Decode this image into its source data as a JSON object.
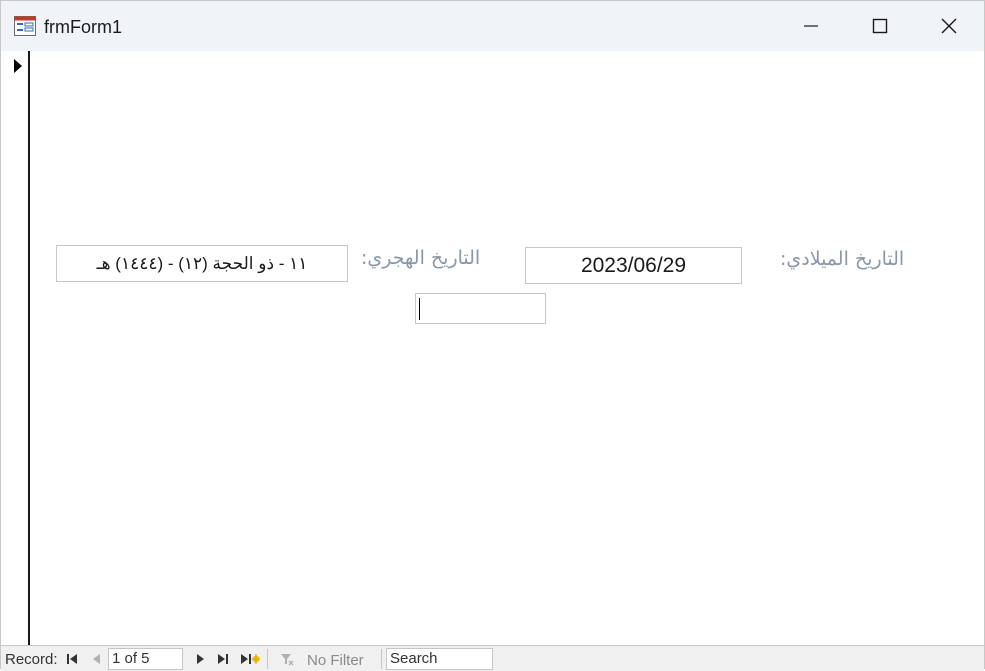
{
  "window": {
    "title": "frmForm1",
    "controls": {
      "minimize": "minimize-icon",
      "maximize": "maximize-icon",
      "close": "close-icon"
    }
  },
  "form": {
    "gregorian_label": "التاريخ الميلادي:",
    "gregorian_value": "2023/06/29",
    "hijri_label": "التاريخ الهجري:",
    "hijri_value": "١١ - ذو الحجة (١٢) - (١٤٤٤) هـ",
    "empty_input_value": ""
  },
  "navigation": {
    "record_label": "Record:",
    "record_position": "1 of 5",
    "filter_label": "No Filter",
    "search_placeholder": "Search"
  },
  "colors": {
    "label_text": "#8a97a8",
    "titlebar_bg": "#f0f4f9",
    "nav_bg": "#f0f0f0"
  }
}
